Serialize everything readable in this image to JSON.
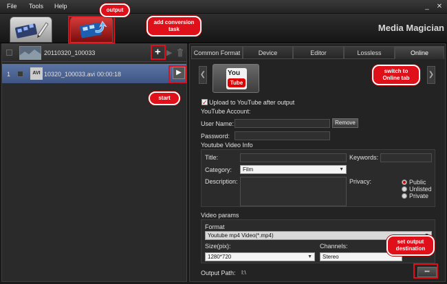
{
  "menubar": {
    "file": "File",
    "tools": "Tools",
    "help": "Help",
    "minimize": "_",
    "close": "✕"
  },
  "toolbar": {
    "brand": "Media Magician"
  },
  "tasks": {
    "group_name": "20110320_100033",
    "item_index": "1",
    "item_format": "AVI",
    "item_name": "10320_100033.avi",
    "item_duration": "00:00:18"
  },
  "tabs": [
    {
      "label": "Common Format"
    },
    {
      "label": "Device"
    },
    {
      "label": "Editor"
    },
    {
      "label": "Lossless"
    },
    {
      "label": "Online"
    }
  ],
  "online": {
    "logo_you": "You",
    "logo_tube": "Tube",
    "upload_label": "Upload to YouTube after output",
    "account_heading": "YouTube Account:",
    "username_label": "User Name:",
    "username_value": "",
    "remove_button": "Remove",
    "password_label": "Password:",
    "password_value": "",
    "video_info_heading": "Youtube Video Info",
    "title_label": "Title:",
    "title_value": "",
    "keywords_label": "Keywords:",
    "keywords_value": "",
    "category_label": "Category:",
    "category_value": "Film",
    "description_label": "Description:",
    "privacy_label": "Privacy:",
    "privacy_options": [
      "Public",
      "Unlisted",
      "Private"
    ],
    "privacy_selected": "Public",
    "video_params_heading": "Video params",
    "format_label": "Format",
    "format_value": "Youtube mp4 Video(*.mp4)",
    "size_label": "Size(pix):",
    "size_value": "1280*720",
    "channels_label": "Channels:",
    "channels_value": "Stereo",
    "output_path_label": "Output Path:",
    "output_path_value": "I:\\",
    "browse_button": "•••"
  },
  "annotations": {
    "output": "output",
    "add_task": "add conversion task",
    "start": "start",
    "switch_online": "switch to Online tab",
    "set_output": "set output destination"
  },
  "colors": {
    "accent_red": "#e0101a",
    "selected_row": "#4a6294"
  }
}
